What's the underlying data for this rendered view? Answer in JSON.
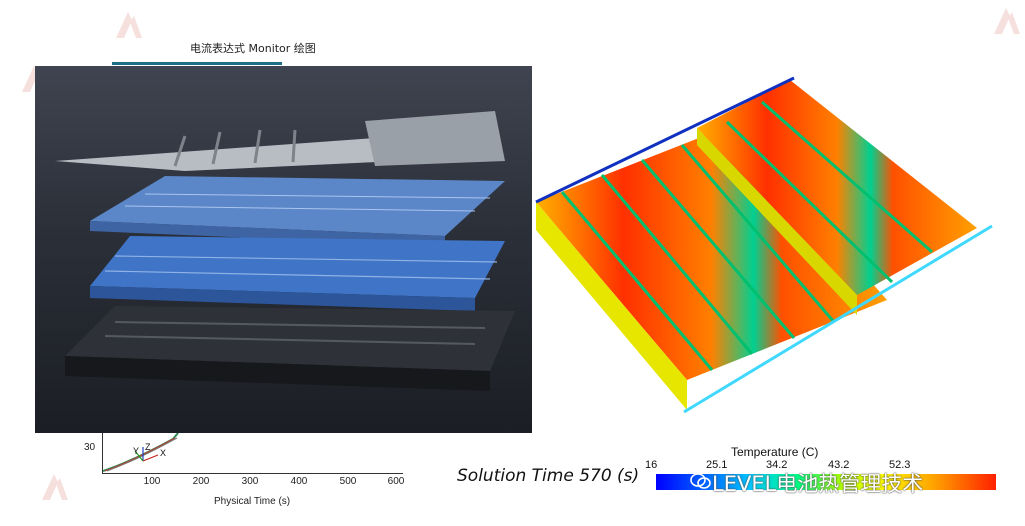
{
  "background_chart": {
    "title": "电流表达式 Monitor 绘图",
    "y_tick": "30",
    "x_ticks": [
      "100",
      "200",
      "300",
      "400",
      "500",
      "600"
    ],
    "x_label": "Physical Time (s)",
    "axis_triad": {
      "x": "X",
      "y": "Y",
      "z": "Z"
    }
  },
  "photo": {
    "subject": "exploded battery pack assembly"
  },
  "simulation": {
    "solution_time": "Solution Time 570 (s)",
    "colorbar": {
      "title": "Temperature (C)",
      "ticks": [
        "16",
        "25.1",
        "34.2",
        "43.2",
        "52.3"
      ],
      "colors": [
        "#0000ff",
        "#00c8ff",
        "#00ff80",
        "#ffff00",
        "#ffa000",
        "#ff2000"
      ]
    }
  },
  "watermark": {
    "text": "LEVEL电池热管理技术",
    "icon": "wechat-icon"
  },
  "colors": {
    "accent": "#1f6f87",
    "logo": "#e8b8b0"
  }
}
